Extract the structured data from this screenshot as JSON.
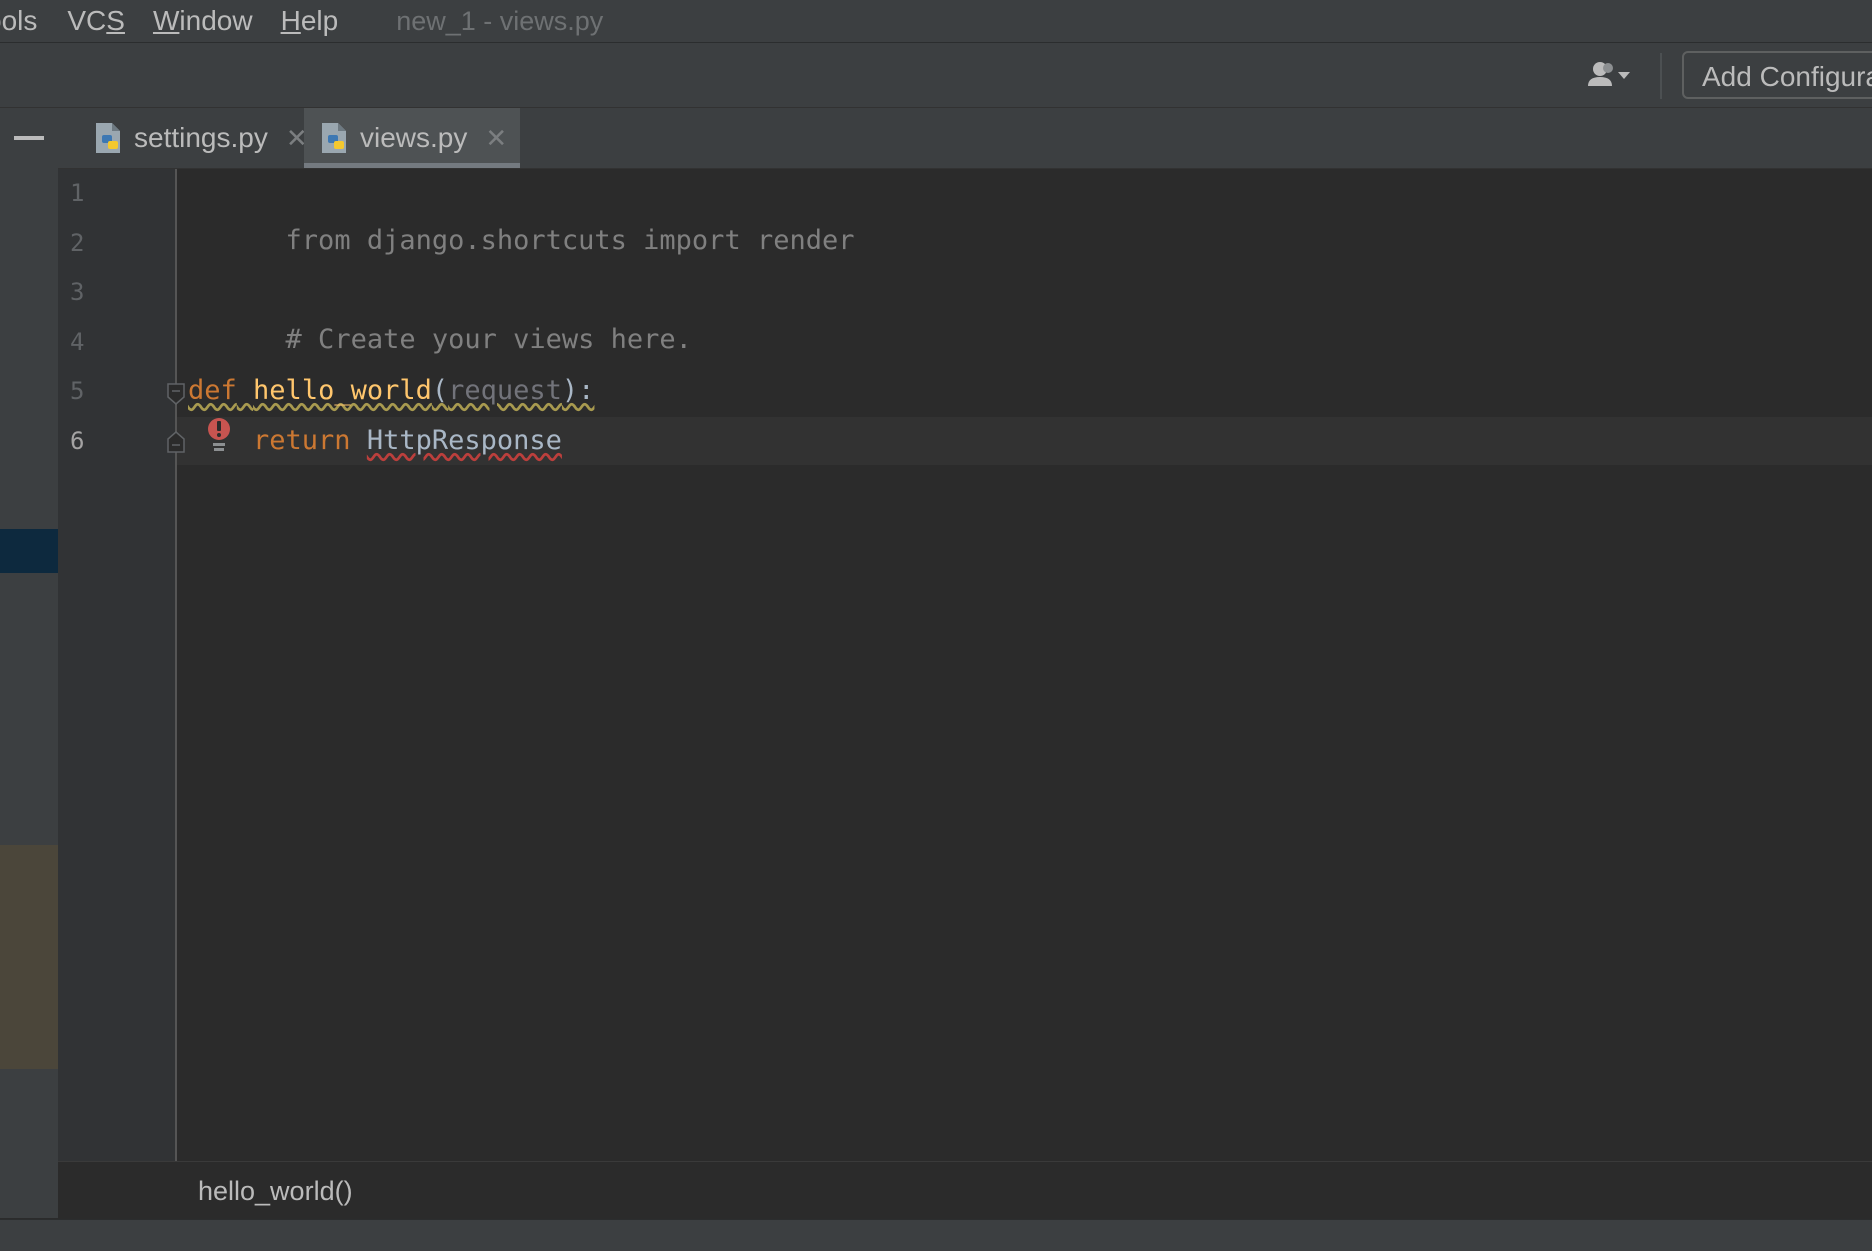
{
  "menubar": {
    "items": [
      {
        "label": "ools",
        "mnemonic": ""
      },
      {
        "label_pre": "VC",
        "label_u": "S",
        "label_post": ""
      },
      {
        "label_pre": "",
        "label_u": "W",
        "label_post": "indow"
      },
      {
        "label_pre": "",
        "label_u": "H",
        "label_post": "elp"
      }
    ],
    "window_title": "new_1 - views.py"
  },
  "toolbar": {
    "user_icon": "user-dropdown-icon",
    "add_config_label": "Add Configura"
  },
  "tabs": [
    {
      "label": "settings.py",
      "icon": "python-file-icon",
      "close": "✕"
    },
    {
      "label": "views.py",
      "icon": "python-file-icon",
      "close": "✕",
      "active": true
    }
  ],
  "editor": {
    "line_numbers": [
      "1",
      "2",
      "3",
      "4",
      "5",
      "6"
    ],
    "lines": {
      "l1_unused": "from django.shortcuts import render",
      "l3_comment": "# Create your views here.",
      "l5_def": "def",
      "l5_name": "hello_world",
      "l5_open": "(",
      "l5_param": "request",
      "l5_close": "):",
      "l6_return": "return",
      "l6_name": "HttpResponse"
    }
  },
  "breadcrumb": "hello_world()",
  "colors": {
    "keyword": "#cc7832",
    "function": "#ffc66d",
    "comment": "#808080",
    "error": "#bc3f3c",
    "warning": "#a89a4f"
  }
}
